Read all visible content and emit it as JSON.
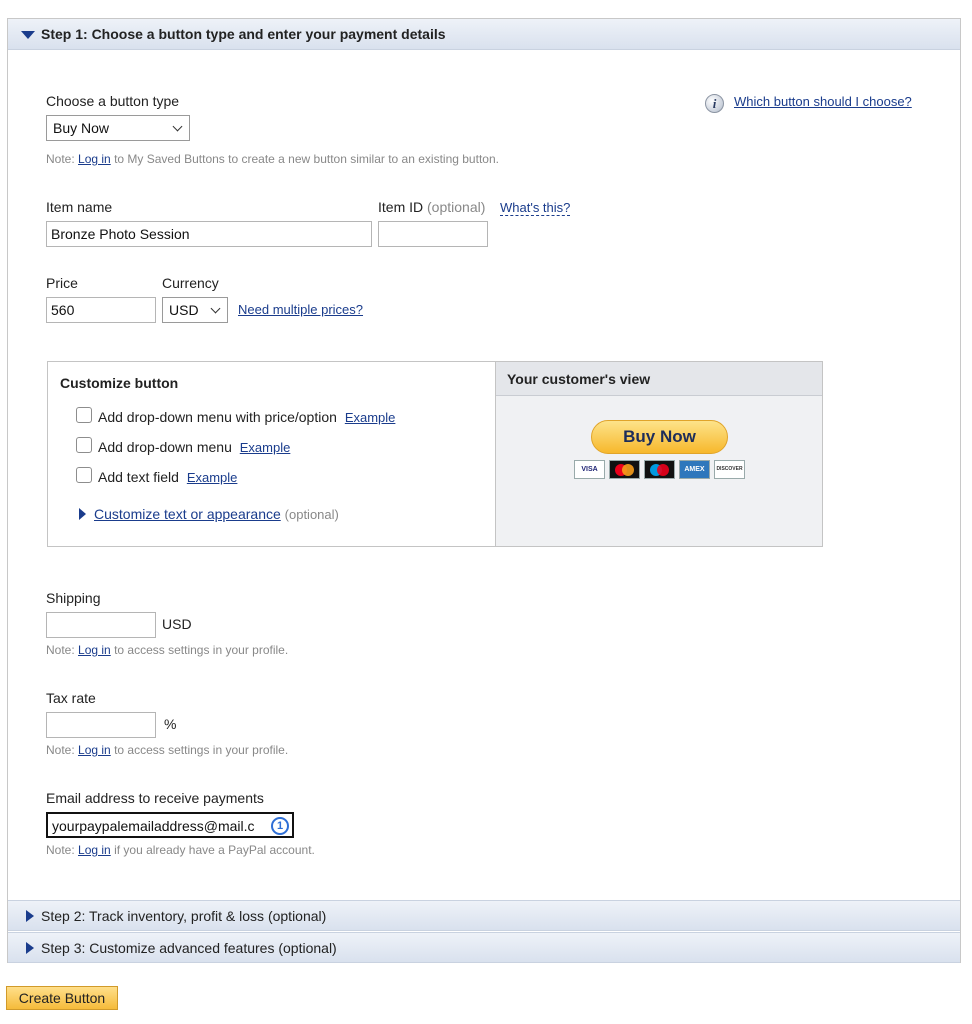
{
  "step1": {
    "title": "Step 1: Choose a button type and enter your payment details"
  },
  "button_type": {
    "label": "Choose a button type",
    "selected": "Buy Now",
    "help_link": "Which button should I choose?",
    "note_prefix": "Note:",
    "note_link": "Log in",
    "note_suffix": "to My Saved Buttons to create a new button similar to an existing button."
  },
  "item": {
    "name_label": "Item name",
    "name_value": "Bronze Photo Session",
    "id_label": "Item ID",
    "id_optional": "(optional)",
    "id_help": "What's this?",
    "id_value": ""
  },
  "price": {
    "label": "Price",
    "value": "560",
    "currency_label": "Currency",
    "currency_selected": "USD",
    "multiple_link": "Need multiple prices?"
  },
  "customize": {
    "title": "Customize button",
    "options": [
      {
        "label": "Add drop-down menu with price/option",
        "link": "Example",
        "checked": false
      },
      {
        "label": "Add drop-down menu",
        "link": "Example",
        "checked": false
      },
      {
        "label": "Add text field",
        "link": "Example",
        "checked": false
      }
    ],
    "appearance_link": "Customize text or appearance",
    "appearance_optional": "(optional)"
  },
  "customer_view": {
    "title": "Your customer's view",
    "button_label": "Buy Now",
    "cards": [
      "VISA",
      "mastercard-icon",
      "maestro-icon",
      "amex-icon",
      "DISCOVER"
    ]
  },
  "shipping": {
    "label": "Shipping",
    "value": "",
    "unit": "USD",
    "note_prefix": "Note:",
    "note_link": "Log in",
    "note_suffix": "to access settings in your profile."
  },
  "tax": {
    "label": "Tax rate",
    "value": "",
    "unit": "%",
    "note_prefix": "Note:",
    "note_link": "Log in",
    "note_suffix": "to access settings in your profile."
  },
  "email": {
    "label": "Email address to receive payments",
    "value": "yourpaypalemailaddress@mail.c",
    "note_prefix": "Note:",
    "note_link": "Log in",
    "note_suffix": "if you already have a PayPal account."
  },
  "step2": {
    "title": "Step 2: Track inventory, profit & loss (optional)"
  },
  "step3": {
    "title": "Step 3: Customize advanced features (optional)"
  },
  "create_button": {
    "label": "Create Button"
  },
  "colors": {
    "link": "#1a3c8c",
    "accent_gold": "#f5bb3b",
    "header_blue": "#d9e1ee"
  }
}
